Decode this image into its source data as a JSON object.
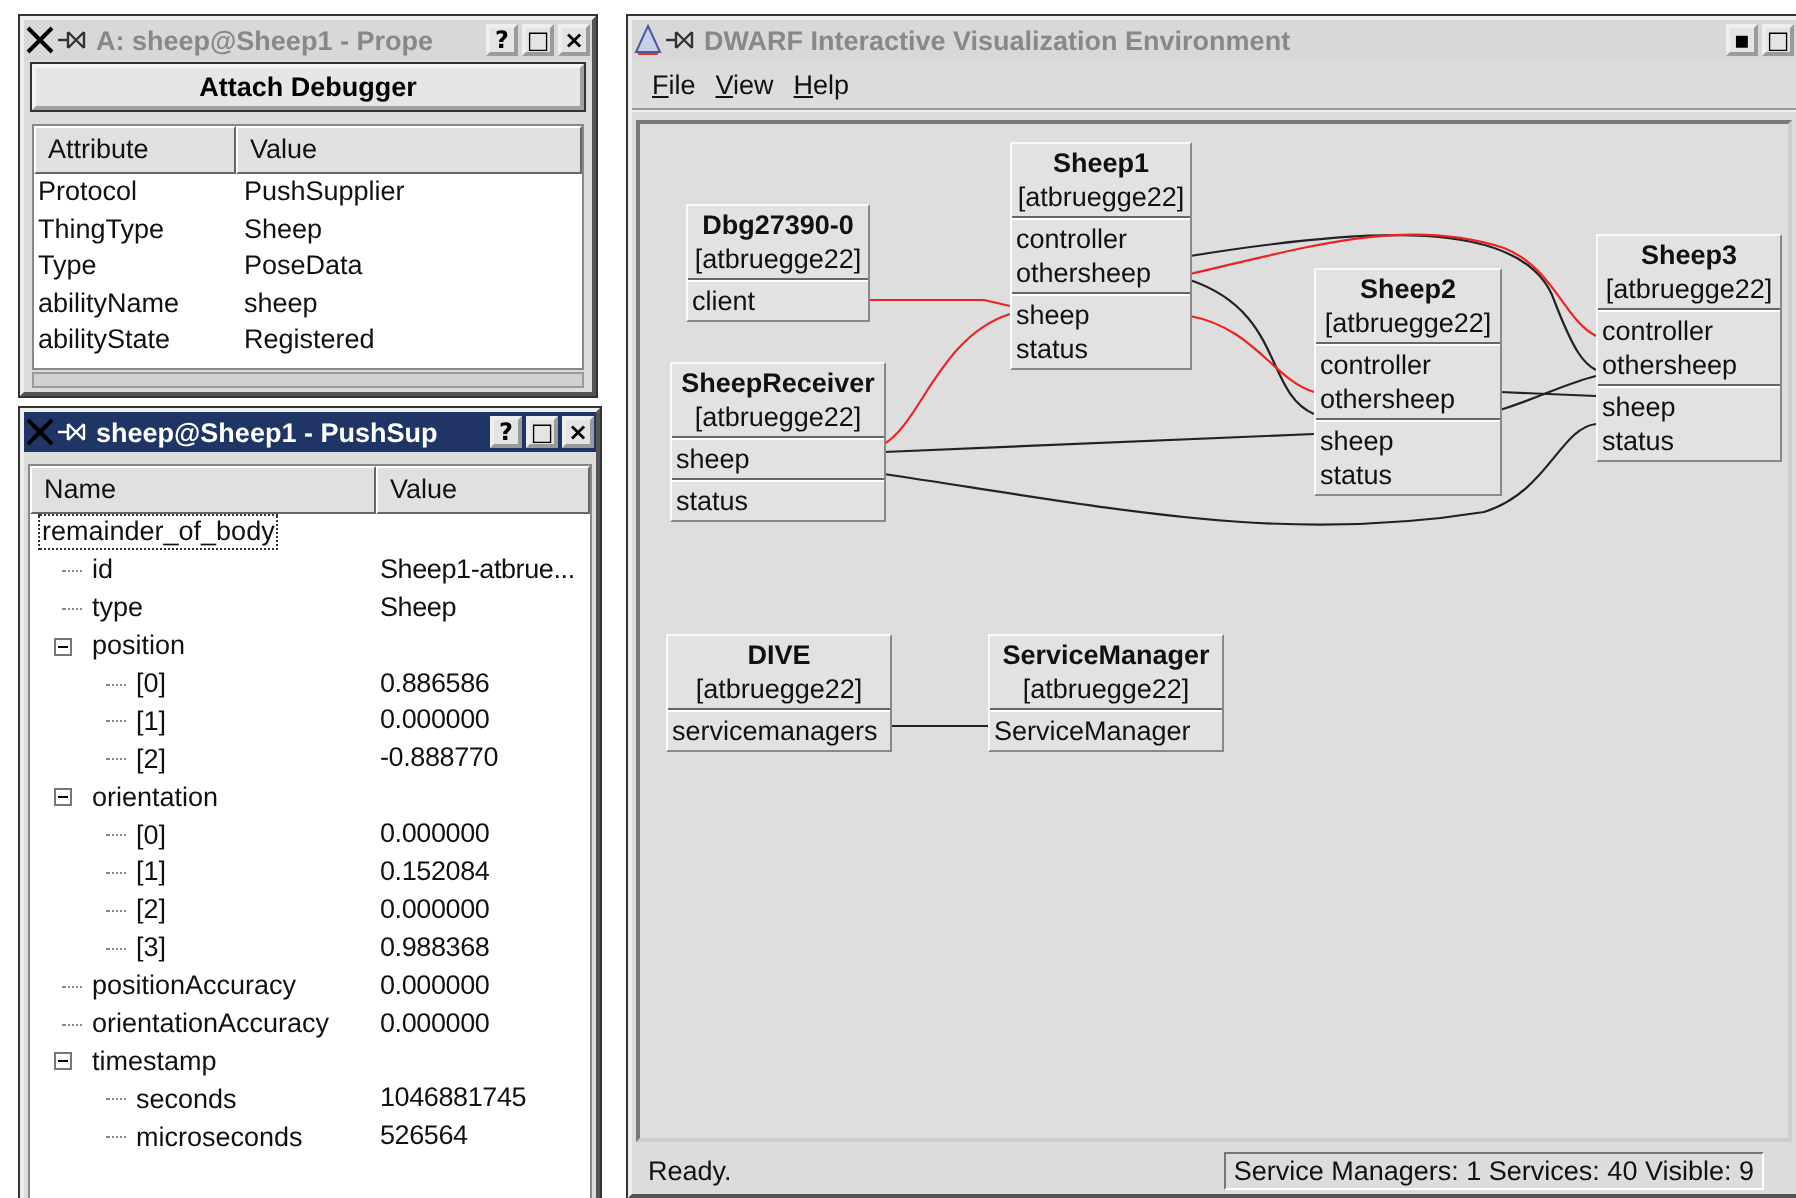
{
  "property_window": {
    "title": "A: sheep@Sheep1 - Prope",
    "active": false,
    "title_buttons": [
      "?",
      "□",
      "×"
    ],
    "button": "Attach Debugger",
    "columns": [
      "Attribute",
      "Value"
    ],
    "rows": [
      {
        "attribute": "Protocol",
        "value": "PushSupplier"
      },
      {
        "attribute": "ThingType",
        "value": "Sheep"
      },
      {
        "attribute": "Type",
        "value": "PoseData"
      },
      {
        "attribute": "abilityName",
        "value": "sheep"
      },
      {
        "attribute": "abilityState",
        "value": "Registered"
      }
    ]
  },
  "data_window": {
    "title": "sheep@Sheep1 - PushSup",
    "active": true,
    "title_buttons": [
      "?",
      "□",
      "×"
    ],
    "columns": [
      "Name",
      "Value"
    ],
    "tree": [
      {
        "name": "remainder_of_body",
        "selected": true,
        "children": [
          {
            "name": "id",
            "value": "Sheep1-atbrue...",
            "selected": false
          },
          {
            "name": "type",
            "value": "Sheep",
            "selected": false
          },
          {
            "name": "position",
            "selected": false,
            "expanded": true,
            "children": [
              {
                "name": "[0]",
                "value": "0.886586",
                "selected": false
              },
              {
                "name": "[1]",
                "value": "0.000000",
                "selected": false
              },
              {
                "name": "[2]",
                "value": "-0.888770",
                "selected": false
              }
            ]
          },
          {
            "name": "orientation",
            "selected": false,
            "expanded": true,
            "children": [
              {
                "name": "[0]",
                "value": "0.000000",
                "selected": false
              },
              {
                "name": "[1]",
                "value": "0.152084",
                "selected": false
              },
              {
                "name": "[2]",
                "value": "0.000000",
                "selected": false
              },
              {
                "name": "[3]",
                "value": "0.988368",
                "selected": false
              }
            ]
          },
          {
            "name": "positionAccuracy",
            "value": "0.000000",
            "selected": false
          },
          {
            "name": "orientationAccuracy",
            "value": "0.000000",
            "selected": false
          },
          {
            "name": "timestamp",
            "selected": false,
            "expanded": true,
            "children": [
              {
                "name": "seconds",
                "value": "1046881745",
                "selected": false
              },
              {
                "name": "microseconds",
                "value": "526564",
                "selected": false
              }
            ]
          }
        ]
      }
    ]
  },
  "main_window": {
    "title": "DWARF Interactive Visualization Environment",
    "active": false,
    "title_buttons": [
      "▪",
      "□"
    ],
    "menu": [
      "File",
      "View",
      "Help"
    ],
    "nodes": [
      {
        "name": "Dbg27390-0",
        "host": "[atbruegge22]",
        "port_groups": [
          {
            "ports": [
              "client"
            ]
          }
        ]
      },
      {
        "name": "Sheep1",
        "host": "[atbruegge22]",
        "port_groups": [
          {
            "ports": [
              "controller",
              "othersheep"
            ]
          },
          {
            "ports": [
              "sheep",
              "status"
            ]
          }
        ]
      },
      {
        "name": "Sheep2",
        "host": "[atbruegge22]",
        "port_groups": [
          {
            "ports": [
              "controller",
              "othersheep"
            ]
          },
          {
            "ports": [
              "sheep",
              "status"
            ]
          }
        ]
      },
      {
        "name": "Sheep3",
        "host": "[atbruegge22]",
        "port_groups": [
          {
            "ports": [
              "controller",
              "othersheep"
            ]
          },
          {
            "ports": [
              "sheep",
              "status"
            ]
          }
        ]
      },
      {
        "name": "SheepReceiver",
        "host": "[atbruegge22]",
        "port_groups": [
          {
            "ports": [
              "sheep"
            ]
          },
          {
            "ports": [
              "status"
            ]
          }
        ]
      },
      {
        "name": "DIVE",
        "host": "[atbruegge22]",
        "port_groups": [
          {
            "ports": [
              "servicemanagers"
            ]
          }
        ]
      },
      {
        "name": "ServiceManager",
        "host": "[atbruegge22]",
        "port_groups": [
          {
            "ports": [
              "ServiceManager"
            ]
          }
        ]
      }
    ],
    "status": "Ready.",
    "status_info": "Service Managers: 1 Services: 40 Visible: 9"
  }
}
